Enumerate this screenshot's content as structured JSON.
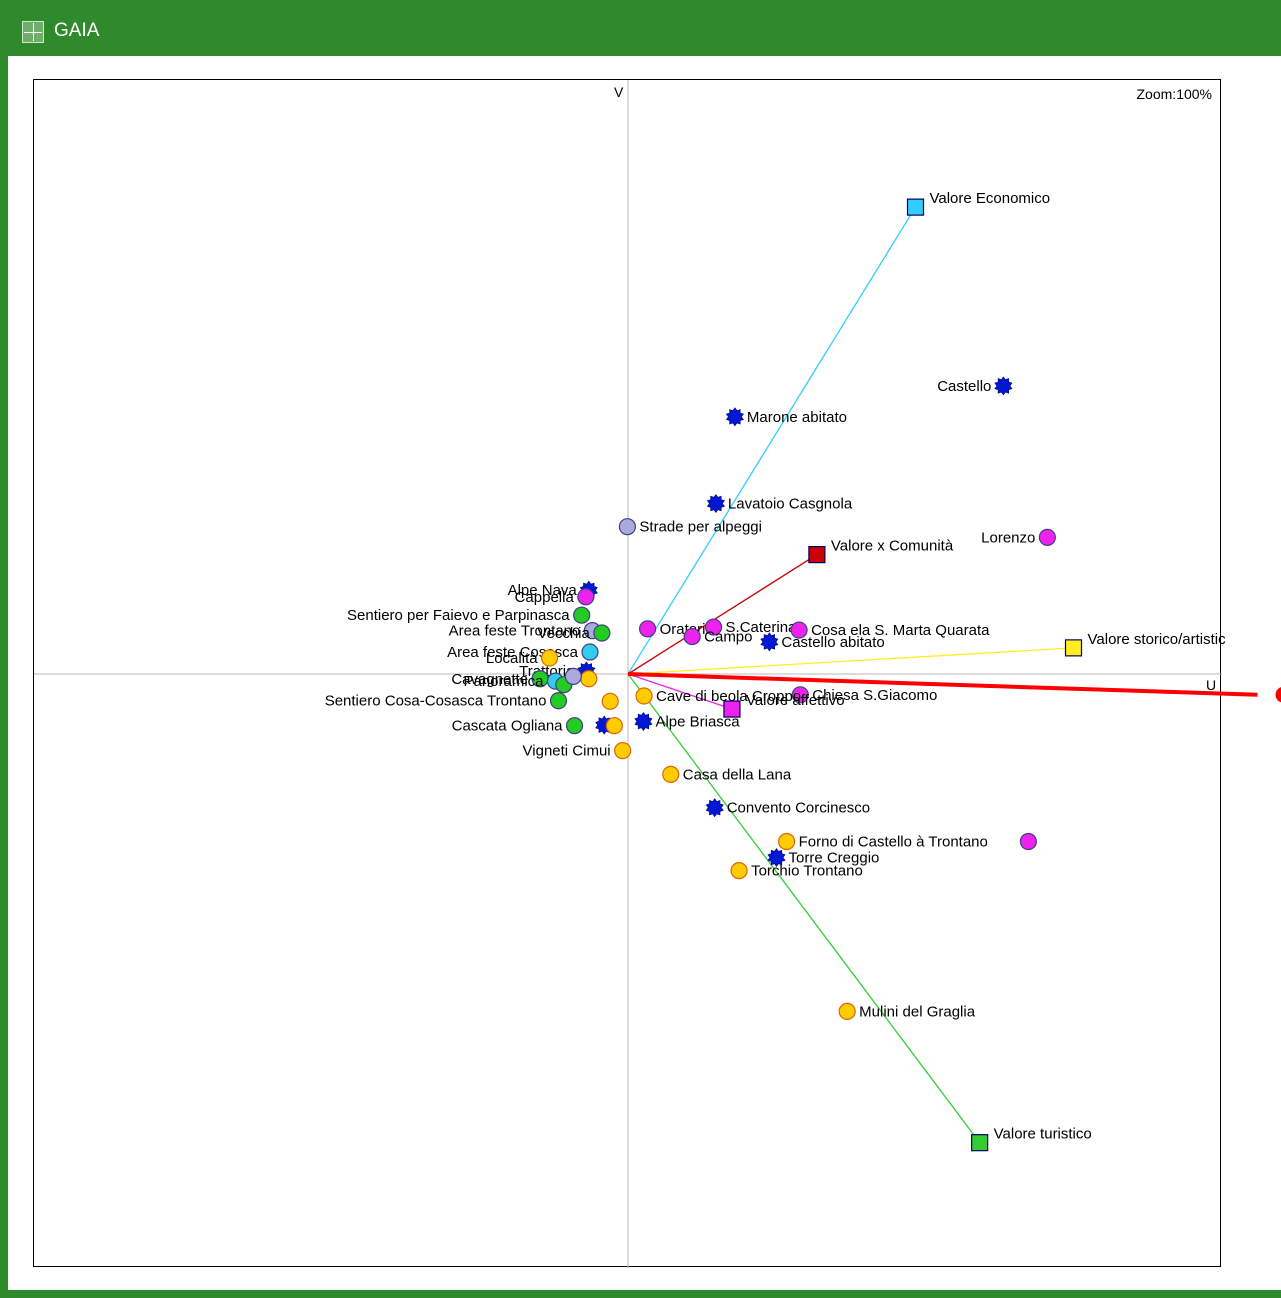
{
  "window": {
    "title": "GAIA",
    "icon": "gaia-app-icon"
  },
  "plot": {
    "zoom_label": "Zoom:",
    "zoom_value": "100%",
    "axis_v": "V",
    "axis_u": "U"
  },
  "colors": {
    "title_bar": "#2e8a2b",
    "decision_axis": "#ff0000",
    "criterion_economico": "#33ccff",
    "criterion_comunita": "#cc0000",
    "criterion_storico": "#ffee22",
    "criterion_affettivo": "#ee22ee",
    "criterion_turistico": "#33cc33"
  },
  "chart_data": {
    "type": "scatter",
    "title": "",
    "xlabel": "U",
    "ylabel": "V",
    "xlim": [
      -1.0,
      1.0
    ],
    "ylim": [
      -1.0,
      1.0
    ],
    "grid": false,
    "decision_axis": {
      "u": 1.08,
      "v": -0.035,
      "color": "#ff0000"
    },
    "criteria": [
      {
        "name": "Valore Economico",
        "u": 0.484,
        "v": 0.786,
        "color": "#33ccff",
        "label_side": "right"
      },
      {
        "name": "Valore x Comunità",
        "u": 0.318,
        "v": 0.201,
        "color": "#cc0000",
        "label_side": "right"
      },
      {
        "name": "Valore storico/artistic",
        "u": 0.75,
        "v": 0.044,
        "color": "#ffee22",
        "label_side": "right"
      },
      {
        "name": "Valore affettivo",
        "u": 0.175,
        "v": -0.059,
        "color": "#ee22ee",
        "label_side": "right"
      },
      {
        "name": "Valore turistico",
        "u": 0.592,
        "v": -0.789,
        "color": "#33cc33",
        "label_side": "right"
      }
    ],
    "alternatives": [
      {
        "label": "Castello",
        "u": 0.632,
        "v": 0.485,
        "color": "#0018d0",
        "shape": "star",
        "label_side": "left"
      },
      {
        "label": "Marone abitato",
        "u": 0.18,
        "v": 0.433,
        "color": "#0018d0",
        "shape": "star",
        "label_side": "right"
      },
      {
        "label": "Lavatoio Casgnola",
        "u": 0.148,
        "v": 0.287,
        "color": "#0018d0",
        "shape": "star",
        "label_side": "right"
      },
      {
        "label": "Strade per alpeggi",
        "u": -0.001,
        "v": 0.248,
        "color": "#aaaadd",
        "shape": "circle",
        "label_side": "right"
      },
      {
        "label": "Lorenzo",
        "u": 0.706,
        "v": 0.23,
        "color": "#ee22ee",
        "shape": "circle",
        "label_side": "left"
      },
      {
        "label": "Oratorio",
        "u": 0.033,
        "v": 0.076,
        "color": "#ee22ee",
        "shape": "circle",
        "label_side": "right"
      },
      {
        "label": "S.Caterina",
        "u": 0.144,
        "v": 0.079,
        "color": "#ee22ee",
        "shape": "circle",
        "label_side": "right"
      },
      {
        "label": "Campo",
        "u": 0.108,
        "v": 0.063,
        "color": "#ee22ee",
        "shape": "circle",
        "label_side": "right"
      },
      {
        "label": "Cosa ela S. Marta Quarata",
        "u": 0.288,
        "v": 0.074,
        "color": "#ee22ee",
        "shape": "circle",
        "label_side": "right"
      },
      {
        "label": "Castello abitato",
        "u": 0.238,
        "v": 0.054,
        "color": "#0018d0",
        "shape": "star",
        "label_side": "right"
      },
      {
        "label": "Chiesa S.Giacomo",
        "u": 0.29,
        "v": -0.035,
        "color": "#ee22ee",
        "shape": "circle",
        "label_side": "right"
      },
      {
        "label": "Cave di beola Croppo",
        "u": 0.027,
        "v": -0.037,
        "color": "#ffcc00",
        "shape": "circle",
        "label_side": "right"
      },
      {
        "label": "Alpe Briasca",
        "u": 0.026,
        "v": -0.08,
        "color": "#0018d0",
        "shape": "star",
        "label_side": "right"
      },
      {
        "label": "Vigneti Cimui",
        "u": -0.009,
        "v": -0.129,
        "color": "#ffcc00",
        "shape": "circle",
        "label_side": "left"
      },
      {
        "label": "Casa della Lana",
        "u": 0.072,
        "v": -0.169,
        "color": "#ffcc00",
        "shape": "circle",
        "label_side": "right"
      },
      {
        "label": "Convento Corcinesco",
        "u": 0.146,
        "v": -0.225,
        "color": "#0018d0",
        "shape": "star",
        "label_side": "right"
      },
      {
        "label": "Forno di Castello à Trontano",
        "u": 0.267,
        "v": -0.282,
        "color": "#ffcc00",
        "shape": "circle",
        "label_side": "right"
      },
      {
        "label": "",
        "u": 0.674,
        "v": -0.282,
        "color": "#ee22ee",
        "shape": "circle",
        "label_side": "right"
      },
      {
        "label": "Torre Creggio",
        "u": 0.25,
        "v": -0.309,
        "color": "#0018d0",
        "shape": "star",
        "label_side": "right"
      },
      {
        "label": "Torchio Trontano",
        "u": 0.187,
        "v": -0.331,
        "color": "#ffcc00",
        "shape": "circle",
        "label_side": "right"
      },
      {
        "label": "Mulini del Graglia",
        "u": 0.369,
        "v": -0.568,
        "color": "#ffcc00",
        "shape": "circle",
        "label_side": "right"
      },
      {
        "label": "Alpe Nava",
        "u": -0.066,
        "v": 0.141,
        "color": "#0018d0",
        "shape": "star",
        "label_side": "left"
      },
      {
        "label": "Cappella",
        "u": -0.071,
        "v": 0.13,
        "color": "#ee22ee",
        "shape": "circle",
        "label_side": "left"
      },
      {
        "label": "Sentiero per Faievo e Parpinasca",
        "u": -0.078,
        "v": 0.099,
        "color": "#22cc22",
        "shape": "circle",
        "label_side": "left"
      },
      {
        "label": "Area feste Trontano",
        "u": -0.06,
        "v": 0.073,
        "color": "#aaaadd",
        "shape": "circle",
        "label_side": "left"
      },
      {
        "label": "Vecchia",
        "u": -0.044,
        "v": 0.069,
        "color": "#22cc22",
        "shape": "circle",
        "label_side": "left"
      },
      {
        "label": "Area feste Cosasca",
        "u": -0.064,
        "v": 0.037,
        "color": "#33ccee",
        "shape": "circle",
        "label_side": "left"
      },
      {
        "label": "Località",
        "u": -0.132,
        "v": 0.027,
        "color": "#ffcc00",
        "shape": "circle",
        "label_side": "left"
      },
      {
        "label": "Trattoria",
        "u": -0.07,
        "v": 0.005,
        "color": "#0018d0",
        "shape": "star",
        "label_side": "left"
      },
      {
        "label": "Cavagnette",
        "u": -0.148,
        "v": -0.008,
        "color": "#22cc22",
        "shape": "circle",
        "label_side": "left"
      },
      {
        "label": "Panoramica",
        "u": -0.122,
        "v": -0.012,
        "color": "#33ccee",
        "shape": "circle",
        "label_side": "left"
      },
      {
        "label": "",
        "u": -0.066,
        "v": -0.008,
        "color": "#ffcc00",
        "shape": "circle",
        "label_side": "left"
      },
      {
        "label": "",
        "u": -0.108,
        "v": -0.018,
        "color": "#22cc22",
        "shape": "circle",
        "label_side": "left"
      },
      {
        "label": "",
        "u": -0.092,
        "v": -0.004,
        "color": "#aaaadd",
        "shape": "circle",
        "label_side": "left"
      },
      {
        "label": "Sentiero Cosa-Cosasca Trontano",
        "u": -0.117,
        "v": -0.045,
        "color": "#22cc22",
        "shape": "circle",
        "label_side": "left"
      },
      {
        "label": "",
        "u": -0.03,
        "v": -0.046,
        "color": "#ffcc00",
        "shape": "circle",
        "label_side": "left"
      },
      {
        "label": "Cascata Ogliana",
        "u": -0.09,
        "v": -0.087,
        "color": "#22cc22",
        "shape": "circle",
        "label_side": "left"
      },
      {
        "label": "",
        "u": -0.04,
        "v": -0.086,
        "color": "#0018d0",
        "shape": "star",
        "label_side": "left"
      },
      {
        "label": "",
        "u": -0.023,
        "v": -0.087,
        "color": "#ffcc00",
        "shape": "circle",
        "label_side": "left"
      }
    ]
  }
}
